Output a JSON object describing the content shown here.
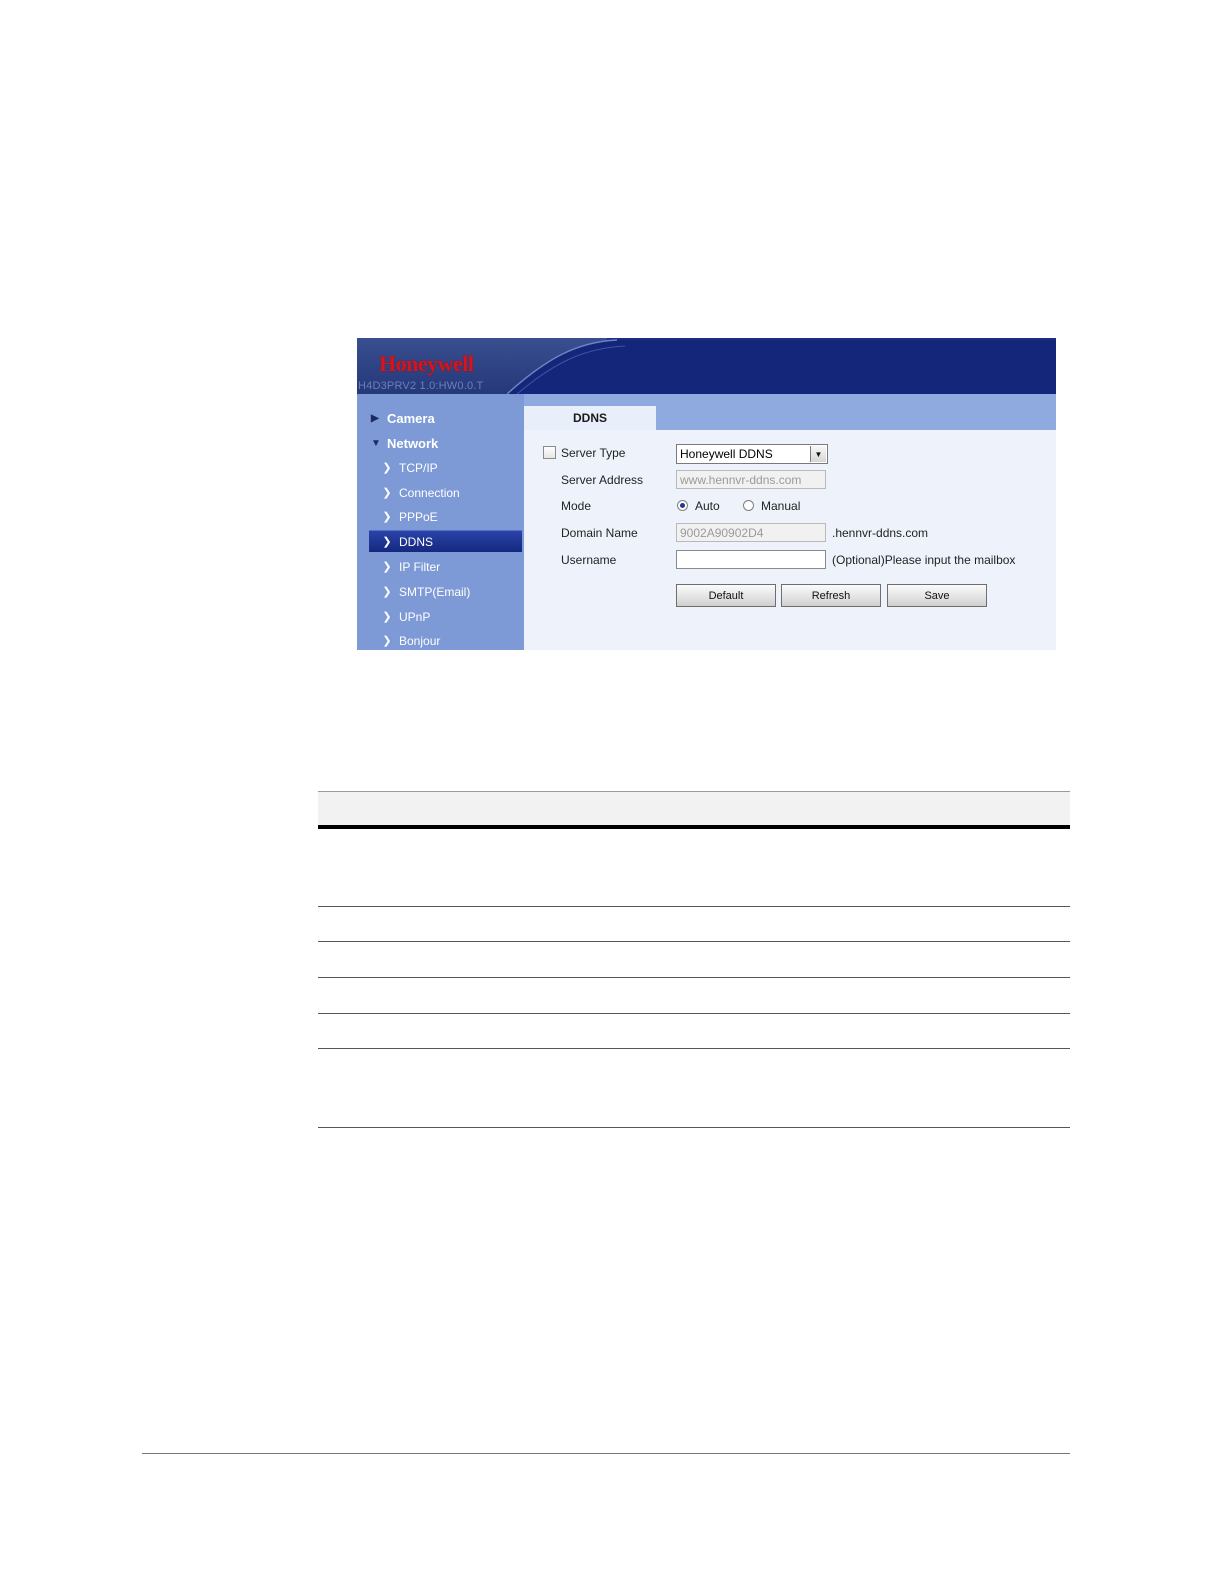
{
  "header": {
    "brand": "Honeywell",
    "model": "H4D3PRV2  1.0:HW0.0.T"
  },
  "sidebar": {
    "groups": [
      {
        "label": "Camera",
        "expanded": false
      },
      {
        "label": "Network",
        "expanded": true
      }
    ],
    "items": [
      {
        "label": "TCP/IP"
      },
      {
        "label": "Connection"
      },
      {
        "label": "PPPoE"
      },
      {
        "label": "DDNS",
        "active": true
      },
      {
        "label": "IP Filter"
      },
      {
        "label": "SMTP(Email)"
      },
      {
        "label": "UPnP"
      },
      {
        "label": "Bonjour"
      }
    ]
  },
  "tab": {
    "label": "DDNS"
  },
  "form": {
    "server_type": {
      "label": "Server Type",
      "checked": false,
      "value": "Honeywell DDNS"
    },
    "server_address": {
      "label": "Server Address",
      "value": "www.hennvr-ddns.com"
    },
    "mode": {
      "label": "Mode",
      "options": [
        "Auto",
        "Manual"
      ],
      "selected": "Auto"
    },
    "domain_name": {
      "label": "Domain Name",
      "value": "9002A90902D4",
      "suffix": ".hennvr-ddns.com"
    },
    "username": {
      "label": "Username",
      "value": "",
      "hint": "(Optional)Please input the mailbox"
    }
  },
  "buttons": {
    "default": "Default",
    "refresh": "Refresh",
    "save": "Save"
  },
  "colors": {
    "brand_red": "#d8141b",
    "banner_blue": "#0d1f6e",
    "sidebar_blue": "#7d9ad6",
    "active_item": "#14287e",
    "tab_strip": "#8eaadf",
    "content_bg": "#eef3fb"
  }
}
